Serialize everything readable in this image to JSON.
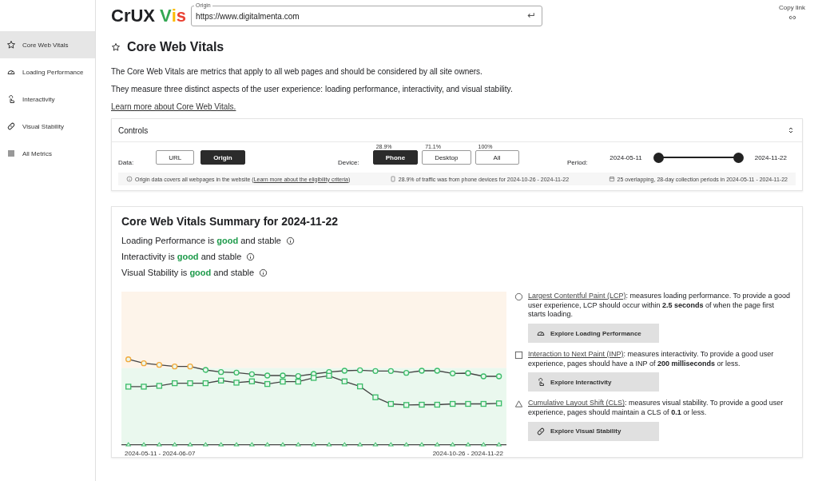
{
  "logo": {
    "parts": [
      {
        "text": "CrUX",
        "color": "#202124"
      },
      {
        "text": "V",
        "color": "#34a853"
      },
      {
        "text": "i",
        "color": "#fbbc04"
      },
      {
        "text": "s",
        "color": "#ea4335"
      }
    ]
  },
  "origin_field": {
    "label": "Origin",
    "value": "https://www.digitalmenta.com"
  },
  "copy_link": {
    "label": "Copy link"
  },
  "sidebar": {
    "items": [
      {
        "label": "Core Web Vitals",
        "kind": "star",
        "selected": true
      },
      {
        "label": "Loading Performance",
        "kind": "gauge",
        "selected": false
      },
      {
        "label": "Interactivity",
        "kind": "pointer",
        "selected": false
      },
      {
        "label": "Visual Stability",
        "kind": "bandage",
        "selected": false
      },
      {
        "label": "All Metrics",
        "kind": "list",
        "selected": false
      }
    ]
  },
  "page": {
    "title": "Core Web Vitals",
    "paragraphs": [
      "The Core Web Vitals are metrics that apply to all web pages and should be considered by all site owners.",
      "They measure three distinct aspects of the user experience: loading performance, interactivity, and visual stability."
    ],
    "learn_more": "Learn more about Core Web Vitals."
  },
  "controls": {
    "title": "Controls",
    "expanded": true,
    "data": {
      "label": "Data:",
      "options": [
        {
          "label": "URL",
          "selected": false
        },
        {
          "label": "Origin",
          "selected": true
        }
      ]
    },
    "device": {
      "label": "Device:",
      "options": [
        {
          "label": "Phone",
          "share": "28.9%",
          "selected": true
        },
        {
          "label": "Desktop",
          "share": "71.1%",
          "selected": false
        },
        {
          "label": "All",
          "share": "100%",
          "selected": false
        }
      ]
    },
    "period": {
      "label": "Period:",
      "start": "2024-05-11",
      "end": "2024-11-22",
      "thumbs": [
        {
          "level": 0
        },
        {
          "level": 1
        }
      ]
    },
    "notes": [
      {
        "kind": "info",
        "text": "Origin data covers all webpages in the website (",
        "link": "Learn more about the eligibility criteria",
        "after": ")"
      },
      {
        "kind": "phone",
        "text": "28.9% of traffic was from phone devices for 2024-10-26 - 2024-11-22"
      },
      {
        "kind": "calendar",
        "text": "25 overlapping, 28-day collection periods in 2024-05-11 - 2024-11-22"
      }
    ]
  },
  "summary": {
    "title": "Core Web Vitals Summary for 2024-11-22",
    "lines": [
      "Loading Performance is **good** and stable",
      "Interactivity is **good** and stable",
      "Visual Stability is **good** and stable"
    ],
    "chart": {
      "x_start": "2024-05-11 - 2024-06-07",
      "x_end": "2024-10-26 - 2024-11-22"
    },
    "metrics": [
      {
        "kind": "circle",
        "name": "Largest Contentful Paint (LCP)",
        "text": ": measures loading performance. To provide a good user experience, LCP should occur within **2.5 seconds** of when the page first starts loading.",
        "button": "Explore Loading Performance"
      },
      {
        "kind": "square",
        "name": "Interaction to Next Paint (INP)",
        "text": ": measures interactivity. To provide a good user experience, pages should have a INP of **200 milliseconds** or less.",
        "button": "Explore Interactivity"
      },
      {
        "kind": "triangle",
        "name": "Cumulative Layout Shift (CLS)",
        "text": ": measures visual stability. To provide a good user experience, pages should maintain a CLS of **0.1** or less.",
        "button": "Explore Visual Stability"
      }
    ]
  }
}
